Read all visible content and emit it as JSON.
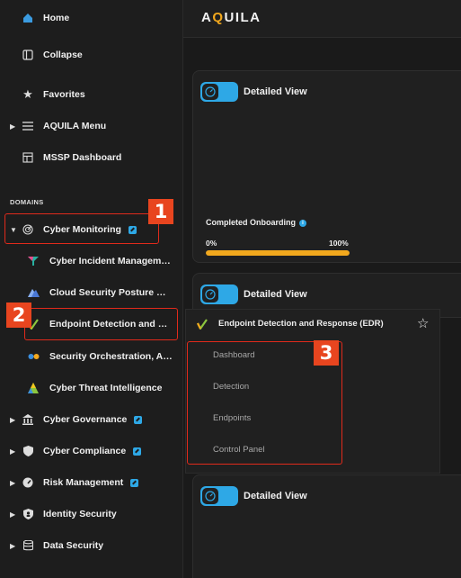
{
  "brand": {
    "logo_prefix": "A",
    "logo_q": "Q",
    "logo_suffix": "UILA"
  },
  "sidebar": {
    "home": "Home",
    "collapse": "Collapse",
    "favorites": "Favorites",
    "aquila_menu": "AQUILA Menu",
    "mssp_dashboard": "MSSP Dashboard",
    "domains_header": "DOMAINS",
    "cyber_monitoring": "Cyber Monitoring",
    "sub": {
      "cim": "Cyber Incident Management",
      "cspm": "Cloud Security Posture Management",
      "edr": "Endpoint Detection and Response",
      "soar": "Security Orchestration, Automation",
      "cti": "Cyber Threat Intelligence"
    },
    "cyber_governance": "Cyber Governance",
    "cyber_compliance": "Cyber Compliance",
    "risk_management": "Risk Management",
    "identity_security": "Identity Security",
    "data_security": "Data Security"
  },
  "cards": {
    "detailed_view": "Detailed View",
    "onboarding_label": "Completed Onboarding",
    "pct_start": "0%",
    "pct_end": "100%",
    "onboarding_progress": 1.0
  },
  "flyout": {
    "title": "Endpoint Detection and Response (EDR)",
    "items": [
      "Dashboard",
      "Detection",
      "Endpoints",
      "Control Panel"
    ]
  },
  "annotations": {
    "one": "1",
    "two": "2",
    "three": "3"
  },
  "colors": {
    "accent": "#2ea8e6",
    "brand": "#f2a81d",
    "annotation": "#e12a1b"
  }
}
